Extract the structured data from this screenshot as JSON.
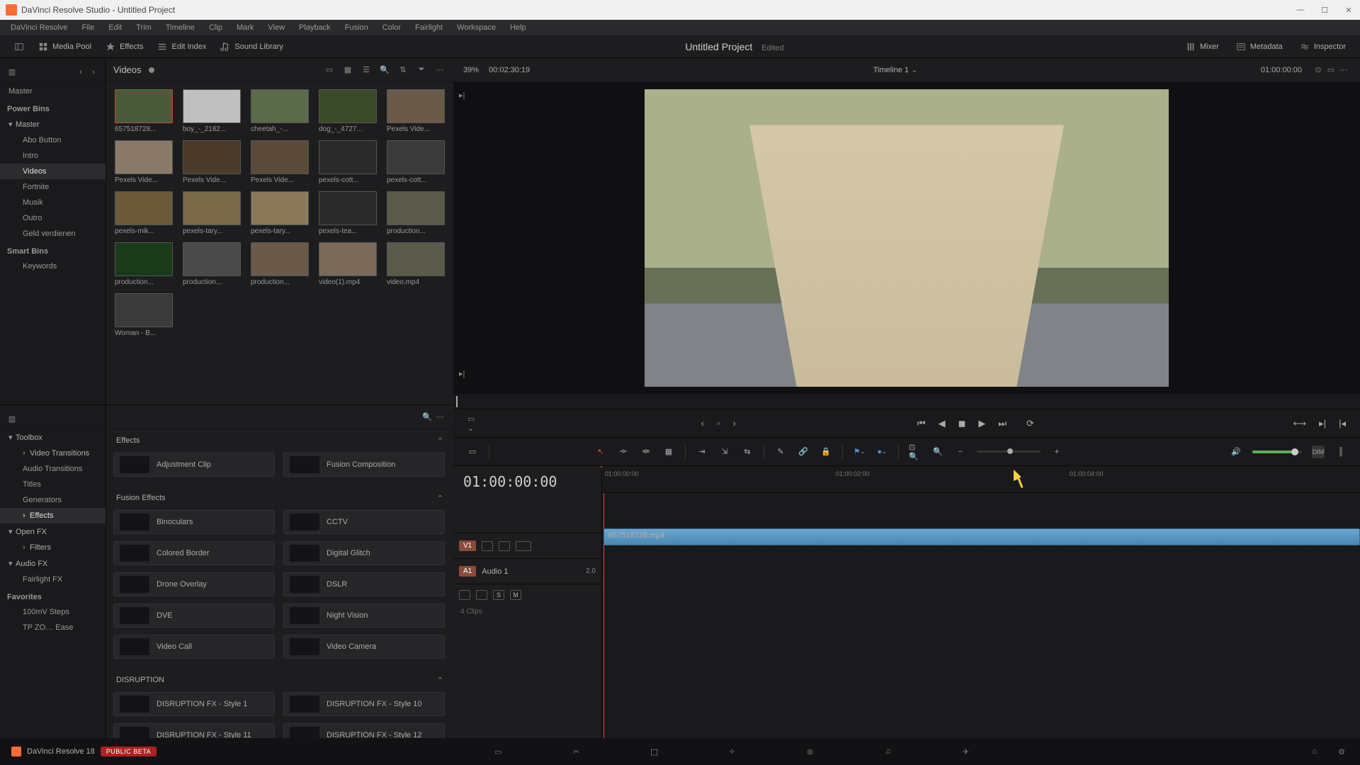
{
  "titlebar": {
    "text": "DaVinci Resolve Studio - Untitled Project"
  },
  "menubar": [
    "DaVinci Resolve",
    "File",
    "Edit",
    "Trim",
    "Timeline",
    "Clip",
    "Mark",
    "View",
    "Playback",
    "Fusion",
    "Color",
    "Fairlight",
    "Workspace",
    "Help"
  ],
  "toolbar": {
    "left": [
      {
        "label": "",
        "icon": "pool-open"
      },
      {
        "label": "Media Pool",
        "icon": "media"
      },
      {
        "label": "Effects",
        "icon": "fx"
      },
      {
        "label": "Edit Index",
        "icon": "index"
      },
      {
        "label": "Sound Library",
        "icon": "sound"
      }
    ],
    "project_title": "Untitled Project",
    "edited": "Edited",
    "right": [
      {
        "label": "Mixer",
        "icon": "mixer"
      },
      {
        "label": "Metadata",
        "icon": "meta"
      },
      {
        "label": "Inspector",
        "icon": "inspect"
      }
    ]
  },
  "bins": {
    "master": "Master",
    "power_header": "Power Bins",
    "power_items": [
      "Master",
      "Abo Button",
      "Intro",
      "Videos",
      "Fortnite",
      "Musik",
      "Outro",
      "Geld verdienen"
    ],
    "power_selected_index": 3,
    "smart_header": "Smart Bins",
    "smart_items": [
      "Keywords"
    ]
  },
  "clips": {
    "title": "Videos",
    "items": [
      "657518728...",
      "boy_-_2182...",
      "cheetah_-...",
      "dog_-_4727...",
      "Pexels Vide...",
      "Pexels Vide...",
      "Pexels Vide...",
      "Pexels Vide...",
      "pexels-cott...",
      "pexels-cott...",
      "pexels-mik...",
      "pexels-tary...",
      "pexels-tary...",
      "pexels-tea...",
      "production...",
      "production...",
      "production...",
      "production...",
      "video(1).mp4",
      "video.mp4",
      "Woman - B..."
    ],
    "selected": [
      0
    ]
  },
  "fx_categories": {
    "tree": [
      "Toolbox",
      "Video Transitions",
      "Audio Transitions",
      "Titles",
      "Generators",
      "Effects",
      "Open FX",
      "Filters",
      "Audio FX",
      "Fairlight FX"
    ],
    "selected_index": 5,
    "fav_header": "Favorites",
    "favorites": [
      "100mV Steps",
      "TP ZO… Ease"
    ]
  },
  "fx": {
    "header_search": "Effects",
    "sections": [
      {
        "name": "Effects",
        "items": [
          "Adjustment Clip",
          "Fusion Composition"
        ]
      },
      {
        "name": "Fusion Effects",
        "items": [
          "Binoculars",
          "CCTV",
          "Colored Border",
          "Digital Glitch",
          "Drone Overlay",
          "DSLR",
          "DVE",
          "Night Vision",
          "Video Call",
          "Video Camera"
        ]
      },
      {
        "name": "DISRUPTION",
        "items": [
          "DISRUPTION FX - Style 1",
          "DISRUPTION FX - Style 10",
          "DISRUPTION FX - Style 11",
          "DISRUPTION FX - Style 12"
        ]
      }
    ]
  },
  "viewer": {
    "zoom": "39%",
    "duration_tc": "00:02:30:19",
    "timeline_name": "Timeline 1",
    "right_tc": "01:00:00:00"
  },
  "timeline": {
    "big_tc": "01:00:00:00",
    "ruler_ticks": [
      "01:00:00:00",
      "01:00:02:00",
      "01:00:04:00"
    ],
    "video_track": {
      "badge": "V1",
      "clip_name": "657518728.mp4"
    },
    "audio_track": {
      "badge": "A1",
      "name": "Audio 1",
      "level": "2.0",
      "clips_meta": "4 Clips",
      "controls": [
        "lock-icon",
        "waveform-icon",
        "solo",
        "mute"
      ]
    }
  },
  "pagebar": {
    "app": "DaVinci Resolve 18",
    "beta": "PUBLIC BETA"
  }
}
